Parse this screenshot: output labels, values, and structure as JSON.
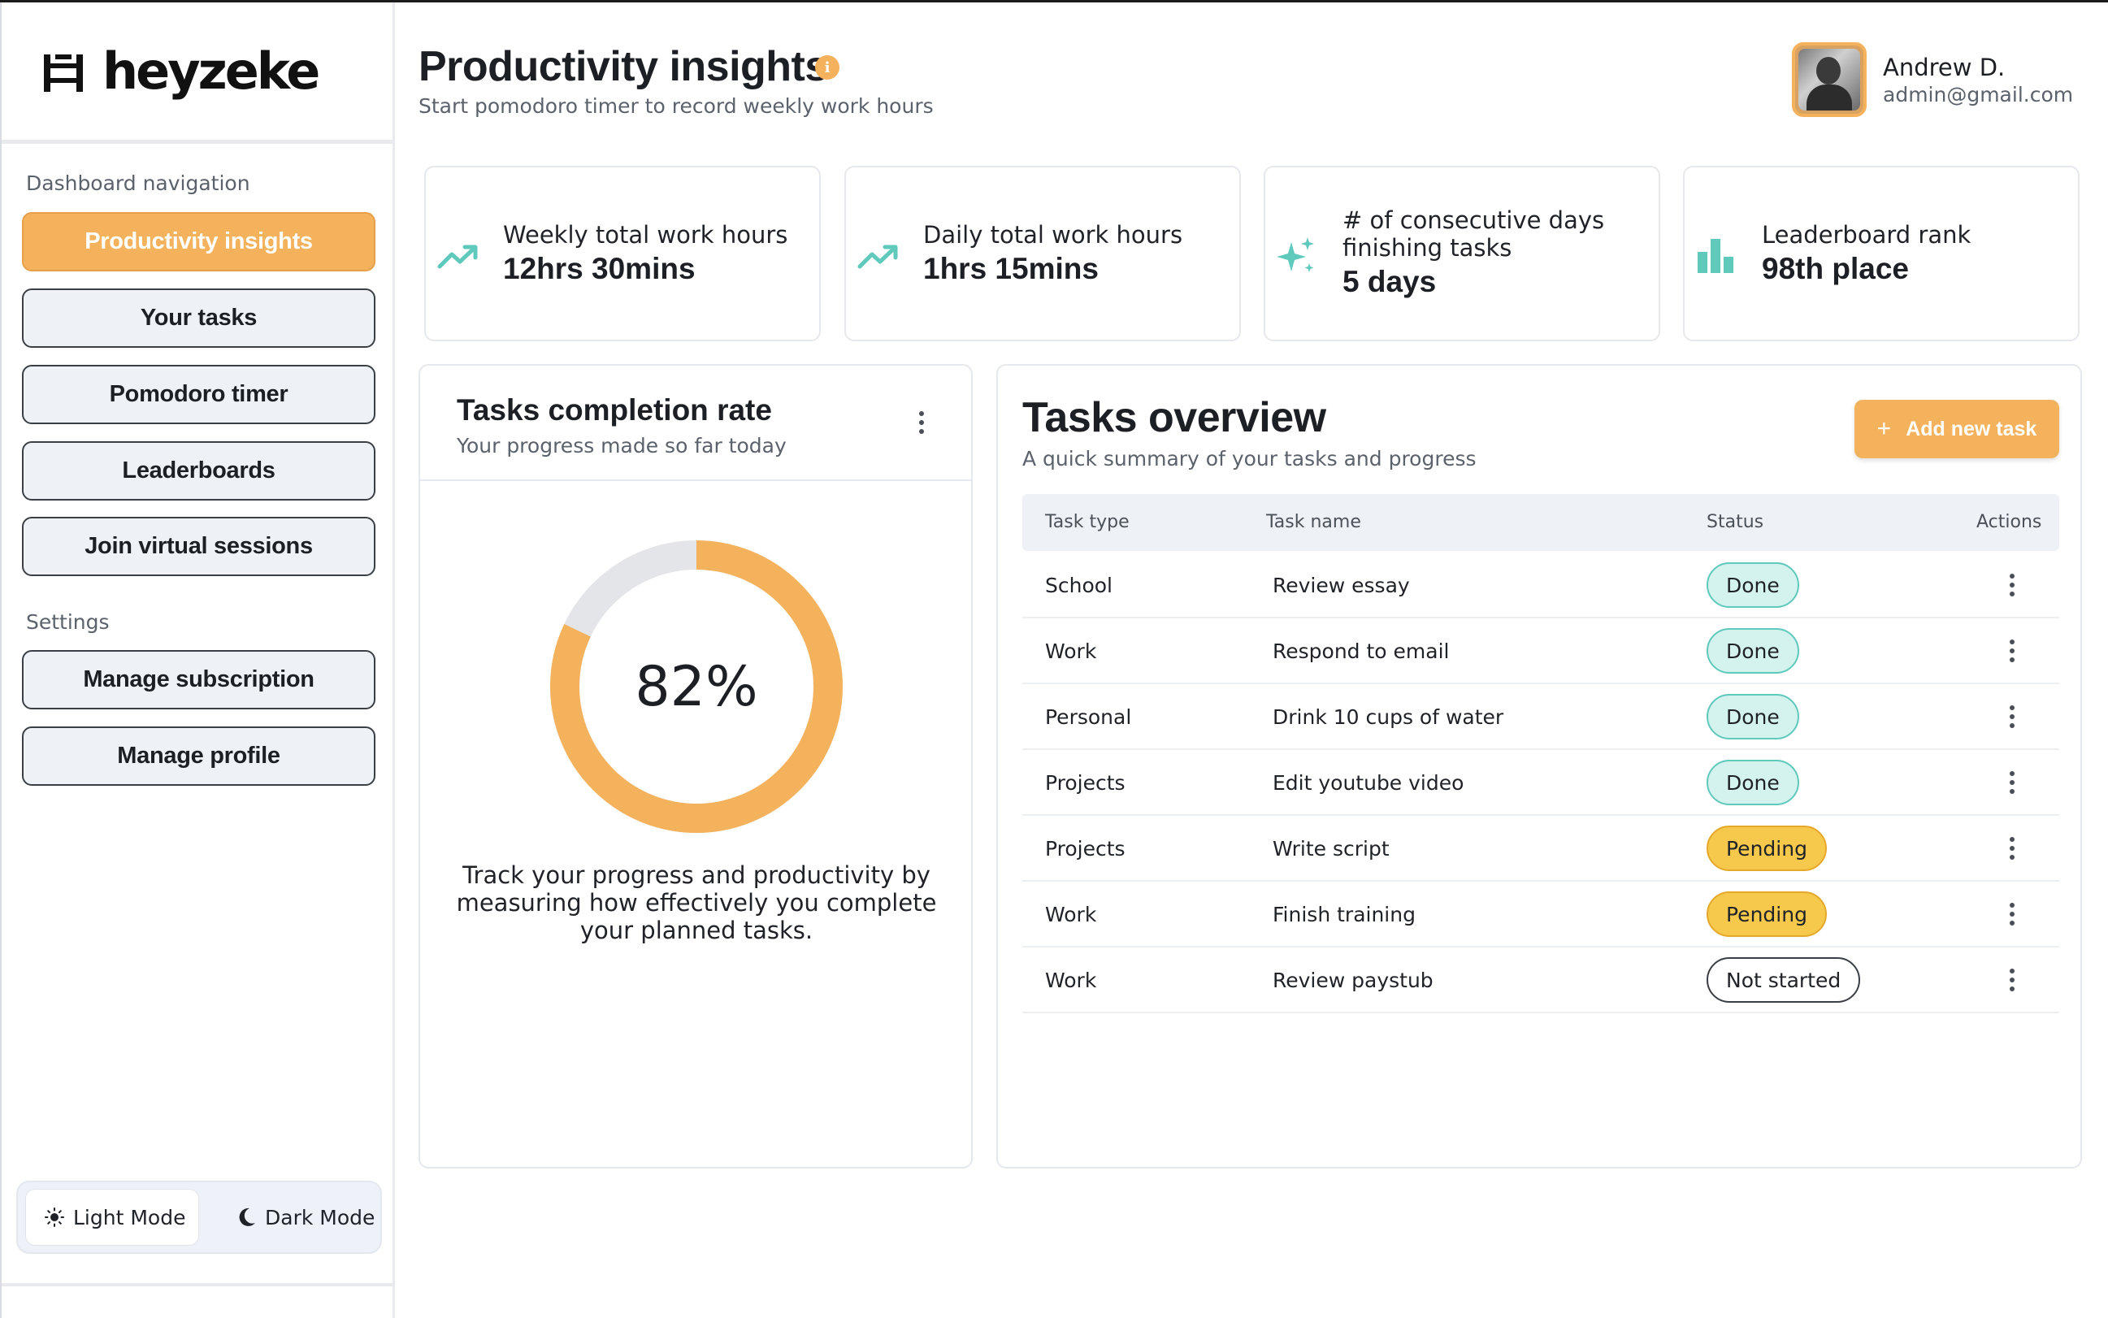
{
  "brand": {
    "name": "heyzeke"
  },
  "sidebar": {
    "nav_heading": "Dashboard navigation",
    "nav_items": [
      {
        "label": "Productivity insights",
        "active": true
      },
      {
        "label": "Your tasks",
        "active": false
      },
      {
        "label": "Pomodoro timer",
        "active": false
      },
      {
        "label": "Leaderboards",
        "active": false
      },
      {
        "label": "Join virtual sessions",
        "active": false
      }
    ],
    "settings_heading": "Settings",
    "settings_items": [
      {
        "label": "Manage subscription"
      },
      {
        "label": "Manage profile"
      }
    ],
    "mode_toggle": {
      "light_label": "Light Mode",
      "dark_label": "Dark Mode",
      "selected": "light"
    }
  },
  "header": {
    "title": "Productivity insights",
    "info_icon": "i",
    "subtitle": "Start pomodoro timer to record weekly work hours",
    "user": {
      "name": "Andrew D.",
      "email": "admin@gmail.com"
    }
  },
  "stats": [
    {
      "icon": "trending-up-icon",
      "label": "Weekly total work hours",
      "value": "12hrs 30mins"
    },
    {
      "icon": "trending-up-icon",
      "label": "Daily total work hours",
      "value": "1hrs 15mins"
    },
    {
      "icon": "sparkles-icon",
      "label": "# of consecutive days finishing tasks",
      "value": "5 days"
    },
    {
      "icon": "bar-chart-icon",
      "label": "Leaderboard rank",
      "value": "98th place"
    }
  ],
  "completion": {
    "title": "Tasks completion rate",
    "subtitle": "Your progress made so far today",
    "percent": 82,
    "percent_label": "82%",
    "description": "Track your progress and productivity by measuring how effectively you complete your planned tasks."
  },
  "overview": {
    "title": "Tasks overview",
    "subtitle": "A quick summary of your tasks and progress",
    "add_button": {
      "icon": "+",
      "label": "Add new task"
    },
    "columns": [
      "Task type",
      "Task name",
      "Status",
      "Actions"
    ],
    "rows": [
      {
        "type": "School",
        "name": "Review essay",
        "status": "Done",
        "status_kind": "done"
      },
      {
        "type": "Work",
        "name": "Respond to email",
        "status": "Done",
        "status_kind": "done"
      },
      {
        "type": "Personal",
        "name": "Drink 10 cups of water",
        "status": "Done",
        "status_kind": "done"
      },
      {
        "type": "Projects",
        "name": "Edit youtube video",
        "status": "Done",
        "status_kind": "done"
      },
      {
        "type": "Projects",
        "name": "Write script",
        "status": "Pending",
        "status_kind": "pending"
      },
      {
        "type": "Work",
        "name": "Finish training",
        "status": "Pending",
        "status_kind": "pending"
      },
      {
        "type": "Work",
        "name": "Review paystub",
        "status": "Not started",
        "status_kind": "notstarted"
      }
    ]
  },
  "colors": {
    "accent": "#f5b25c",
    "teal": "#5fc9bc",
    "pending": "#f6c84c",
    "track": "#e3e5e8"
  }
}
